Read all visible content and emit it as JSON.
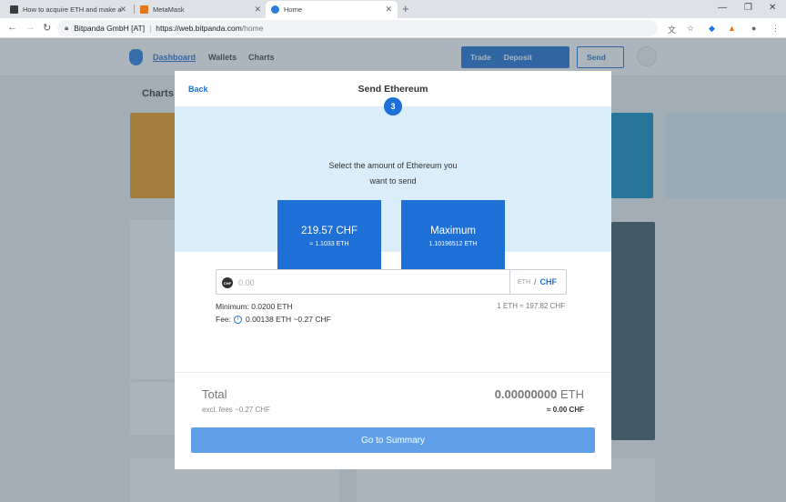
{
  "browser": {
    "tabs": [
      {
        "title": "How to acquire ETH and make a",
        "color": "#3c3c3c"
      },
      {
        "title": "MetaMask",
        "color": "#e2761b"
      },
      {
        "title": "Home",
        "color": "#2a7de1"
      }
    ],
    "site_identity": "Bitpanda GmbH [AT]",
    "url_host": "https://web.bitpanda.com",
    "url_path": "/home"
  },
  "app": {
    "nav": {
      "dashboard": "Dashboard",
      "wallets": "Wallets",
      "charts": "Charts"
    },
    "trade_label": "Trade",
    "deposit_label": "Deposit",
    "send_label": "Send",
    "charts_heading": "Charts"
  },
  "modal": {
    "back": "Back",
    "title": "Send Ethereum",
    "step": "3",
    "prompt_line1": "Select the amount of Ethereum you",
    "prompt_line2": "want to send",
    "option1": {
      "main": "219.57 CHF",
      "sub": "≈ 1.1033 ETH"
    },
    "option2": {
      "main": "Maximum",
      "sub": "1.10196512 ETH"
    },
    "input": {
      "badge": "CHF",
      "placeholder": "0.00",
      "value": ""
    },
    "unit_eth": "ETH",
    "unit_slash": "/",
    "unit_chf": "CHF",
    "minimum": "Minimum: 0.0200 ETH",
    "rate": "1 ETH ≈ 197.82 CHF",
    "fee_label": "Fee:",
    "fee_value": "0.00138 ETH ~0.27 CHF",
    "total_label": "Total",
    "total_amount": "0.00000000",
    "total_unit": "ETH",
    "excl_fees": "excl. fees ~0.27 CHF",
    "total_fiat": "≈ 0.00 CHF",
    "summary_button": "Go to Summary"
  },
  "colors": {
    "accent": "#1e6fd6",
    "band": "#d9eefa",
    "summary_button": "#5fa0e8"
  }
}
